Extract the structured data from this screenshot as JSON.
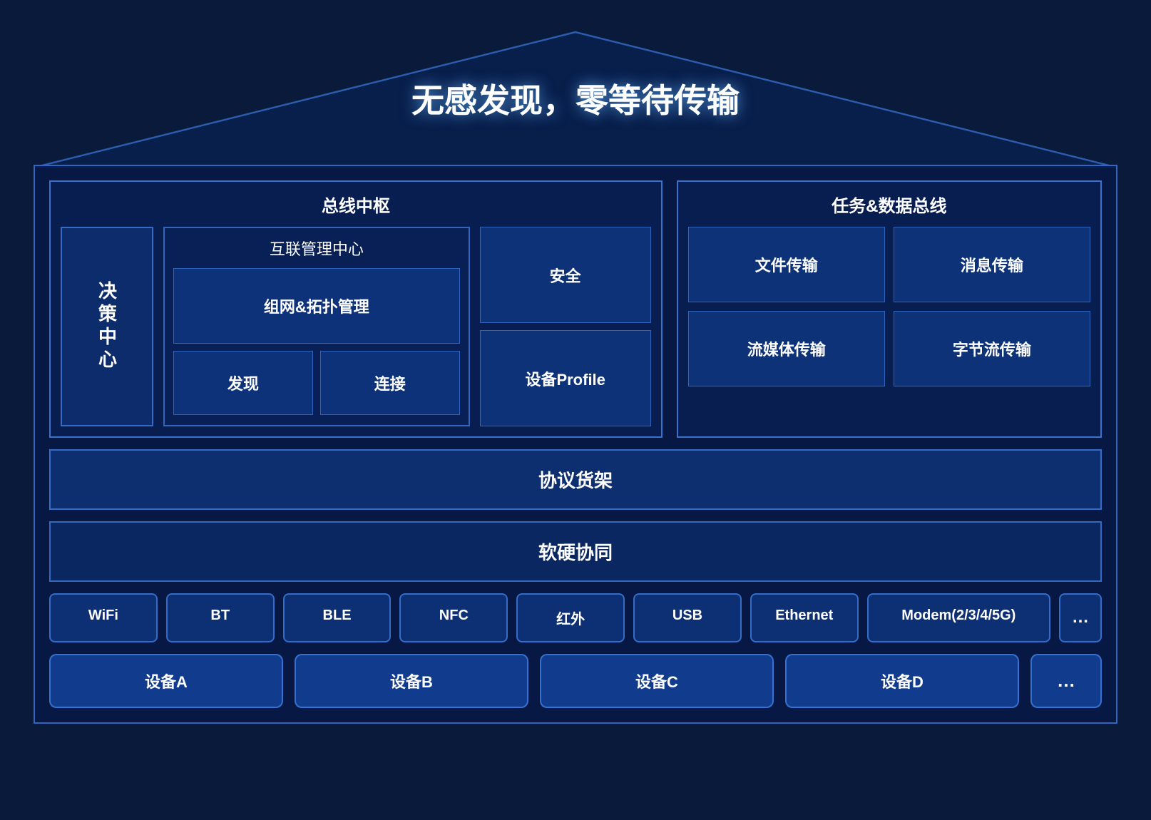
{
  "page": {
    "background": "#0a1a3a",
    "title": "无感发现，零等待传输",
    "sections": {
      "busHub": {
        "label": "总线中枢",
        "decisionCenter": "决策中心",
        "interconnect": {
          "label": "互联管理中心",
          "networkTopo": "组网&拓扑管理",
          "discovery": "发现",
          "connection": "连接",
          "security": "安全",
          "deviceProfile": "设备Profile"
        }
      },
      "taskDataBus": {
        "label": "任务&数据总线",
        "fileTransfer": "文件传输",
        "messageTransfer": "消息传输",
        "streamTransfer": "流媒体传输",
        "byteTransfer": "字节流传输"
      },
      "protocolShelf": "协议货架",
      "swHwCollab": "软硬协同",
      "hardware": {
        "items": [
          "WiFi",
          "BT",
          "BLE",
          "NFC",
          "红外",
          "USB",
          "Ethernet",
          "Modem(2/3/4/5G)",
          "..."
        ]
      },
      "devices": {
        "items": [
          "设备A",
          "设备B",
          "设备C",
          "设备D",
          "..."
        ]
      }
    }
  }
}
